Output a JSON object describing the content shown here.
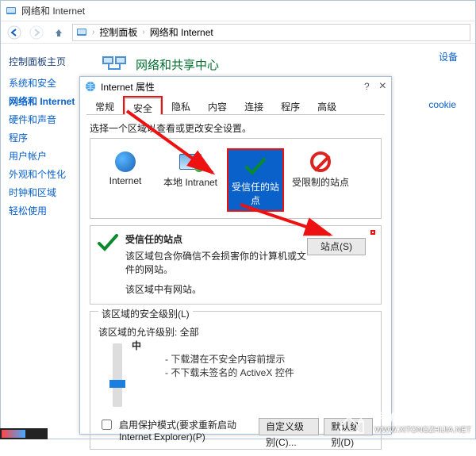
{
  "window": {
    "title": "网络和 Internet",
    "breadcrumb": {
      "cp": "控制面板",
      "section": "网络和 Internet"
    }
  },
  "sidebar": {
    "home": "控制面板主页",
    "items": [
      "系统和安全",
      "网络和 Internet",
      "硬件和声音",
      "程序",
      "用户帐户",
      "外观和个性化",
      "时钟和区域",
      "轻松使用"
    ],
    "active_index": 1
  },
  "content": {
    "title": "网络和共享中心",
    "link_settings": "设备",
    "link_cookie": "cookie"
  },
  "dialog": {
    "title": "Internet 属性",
    "help": "?",
    "close": "×",
    "tabs": [
      "常规",
      "安全",
      "隐私",
      "内容",
      "连接",
      "程序",
      "高级"
    ],
    "active_tab": 1,
    "instruction": "选择一个区域以查看或更改安全设置。",
    "zones": [
      {
        "label": "Internet"
      },
      {
        "label": "本地 Intranet"
      },
      {
        "label": "受信任的站点"
      },
      {
        "label": "受限制的站点"
      }
    ],
    "trusted": {
      "title": "受信任的站点",
      "desc": "该区域包含你确信不会损害你的计算机或文件的网站。",
      "note": "该区域中有网站。",
      "sites_btn": "站点(S)"
    },
    "level": {
      "heading": "该区域的安全级别(L)",
      "allowed": "该区域的允许级别: 全部",
      "value": "中",
      "bullets": [
        "下载潜在不安全内容前提示",
        "不下载未签名的 ActiveX 控件"
      ]
    },
    "protected": "启用保护模式(要求重新启动 Internet Explorer)(P)",
    "btn_custom": "自定义级别(C)...",
    "btn_default": "默认级别(D)"
  },
  "watermark": {
    "zh": "系统之家",
    "en": "WWW.XITONGZHIJIA.NET"
  }
}
